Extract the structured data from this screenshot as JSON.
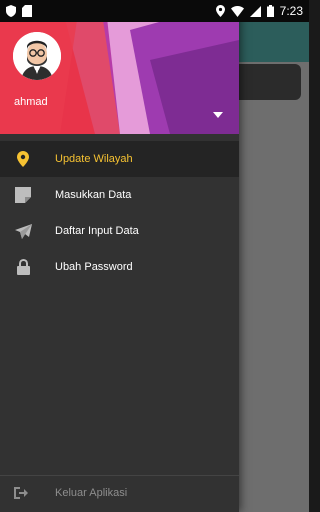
{
  "status_bar": {
    "time": "7:23",
    "icons": [
      "shield-icon",
      "sd-card-icon",
      "location-icon",
      "wifi-icon",
      "signal-icon",
      "battery-icon"
    ]
  },
  "drawer": {
    "user": {
      "name": "ahmad"
    },
    "menu_items": [
      {
        "label": "Update Wilayah",
        "icon": "location-pin-icon",
        "active": true
      },
      {
        "label": "Masukkan Data",
        "icon": "note-icon",
        "active": false
      },
      {
        "label": "Daftar Input Data",
        "icon": "send-icon",
        "active": false
      },
      {
        "label": "Ubah Password",
        "icon": "lock-icon",
        "active": false
      }
    ],
    "footer": {
      "label": "Keluar Aplikasi",
      "icon": "logout-icon"
    }
  },
  "colors": {
    "active": "#f6c232",
    "drawer_bg": "#323232",
    "header_red": "#e8344a",
    "header_purple": "#8b2fa5"
  }
}
